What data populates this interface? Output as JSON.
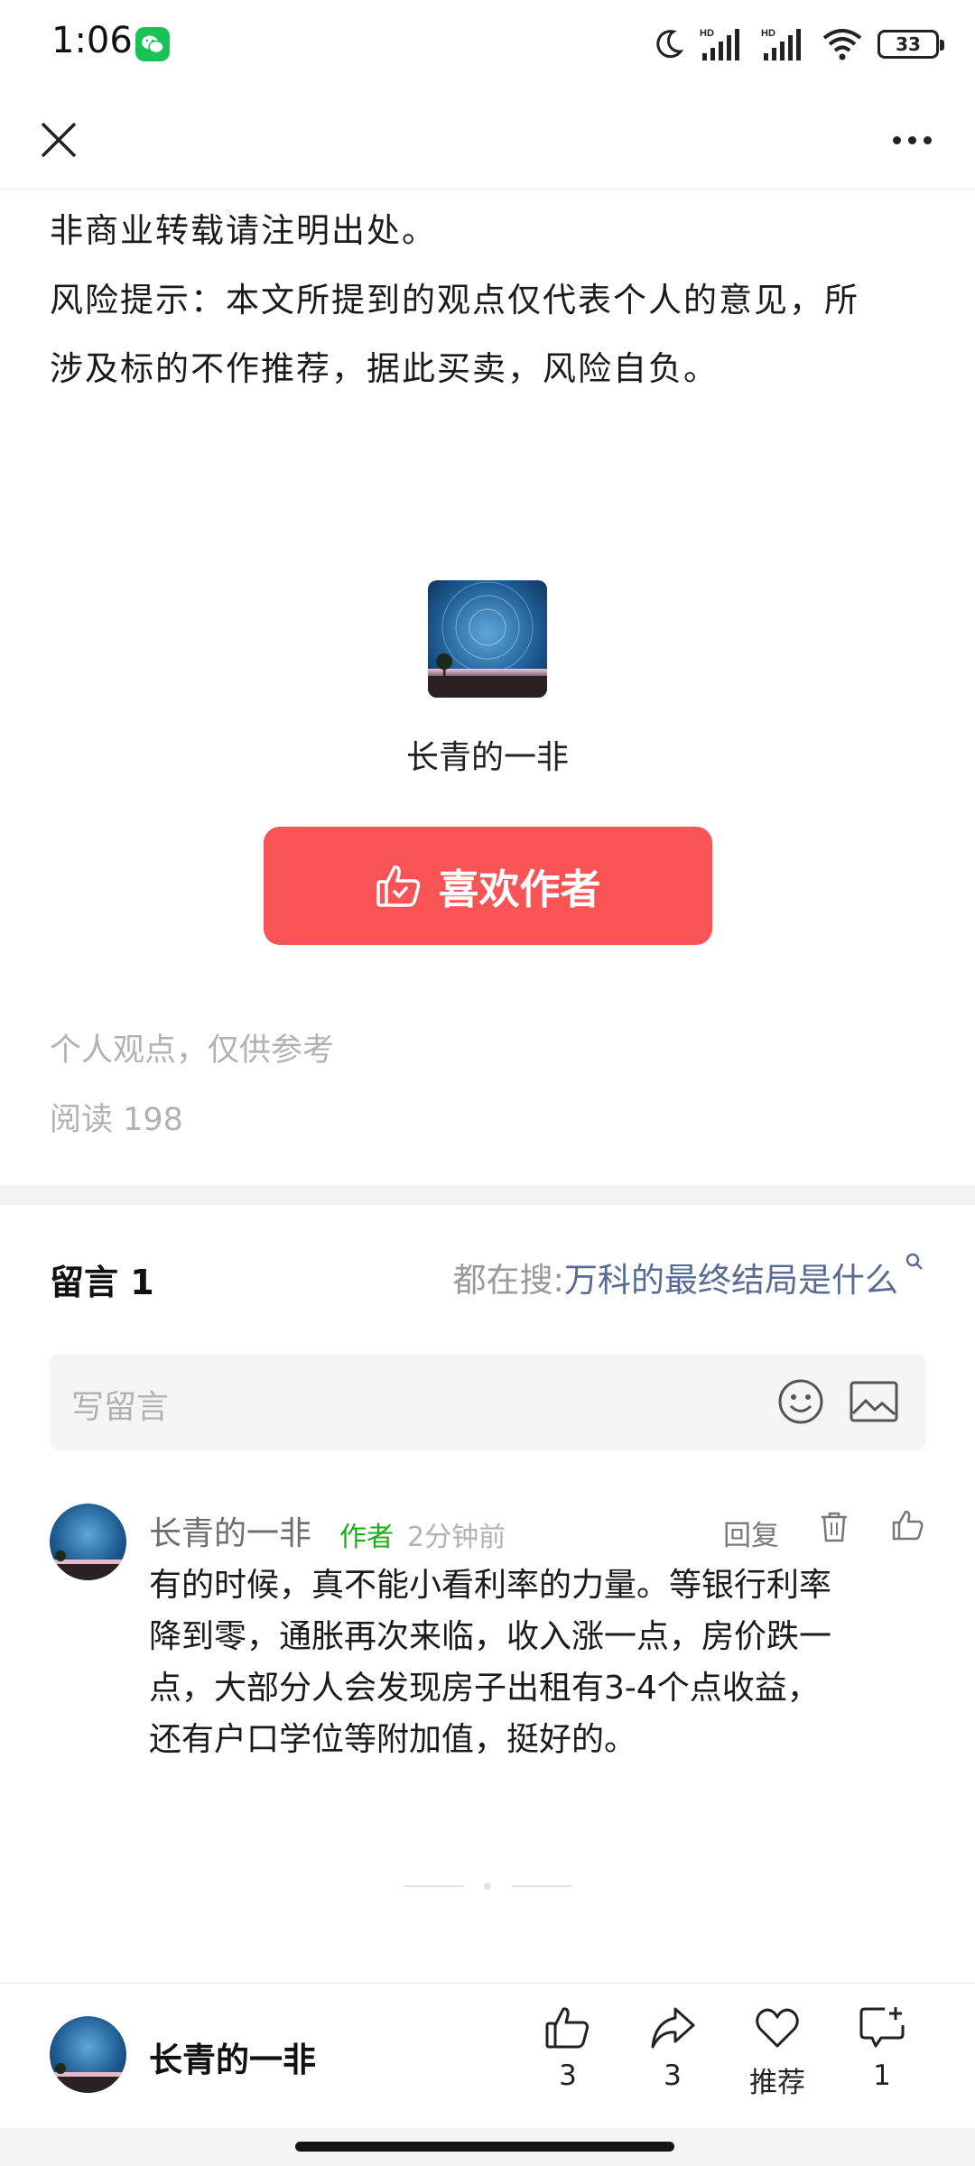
{
  "status_bar": {
    "time": "1:06",
    "battery": "33",
    "icons": [
      "wechat-icon",
      "moon-icon",
      "signal-hd-icon",
      "signal-hd-icon",
      "wifi-icon",
      "battery-icon"
    ]
  },
  "nav": {
    "close_icon": "close-icon",
    "more_icon": "more-icon"
  },
  "article": {
    "lines": [
      "非商业转载请注明出处。",
      "风险提示：本文所提到的观点仅代表个人的意见，所",
      "涉及标的不作推荐，据此买卖，风险自负。"
    ]
  },
  "author_card": {
    "name": "长青的一非",
    "like_button": "喜欢作者"
  },
  "meta": {
    "disclaimer": "个人观点，仅供参考",
    "reads": "阅读 198"
  },
  "comments": {
    "title": "留言 1",
    "search_prefix": "都在搜: ",
    "search_query": "万科的最终结局是什么",
    "input_placeholder": "写留言",
    "items": [
      {
        "name": "长青的一非",
        "tag": "作者",
        "time": "2分钟前",
        "reply": "回复",
        "body_lines": [
          "有的时候，真不能小看利率的力量。等银行利率",
          "降到零，通胀再次来临，收入涨一点，房价跌一",
          "点，大部分人会发现房子出租有3-4个点收益，",
          "还有户口学位等附加值，挺好的。"
        ]
      }
    ]
  },
  "bottom_bar": {
    "author_name": "长青的一非",
    "like_count": "3",
    "share_count": "3",
    "recommend_label": "推荐",
    "comment_count": "1"
  },
  "colors": {
    "like_button_bg": "#f95455",
    "link_blue": "#576b95",
    "author_tag_green": "#1aad19",
    "wechat_green": "#18c356"
  }
}
